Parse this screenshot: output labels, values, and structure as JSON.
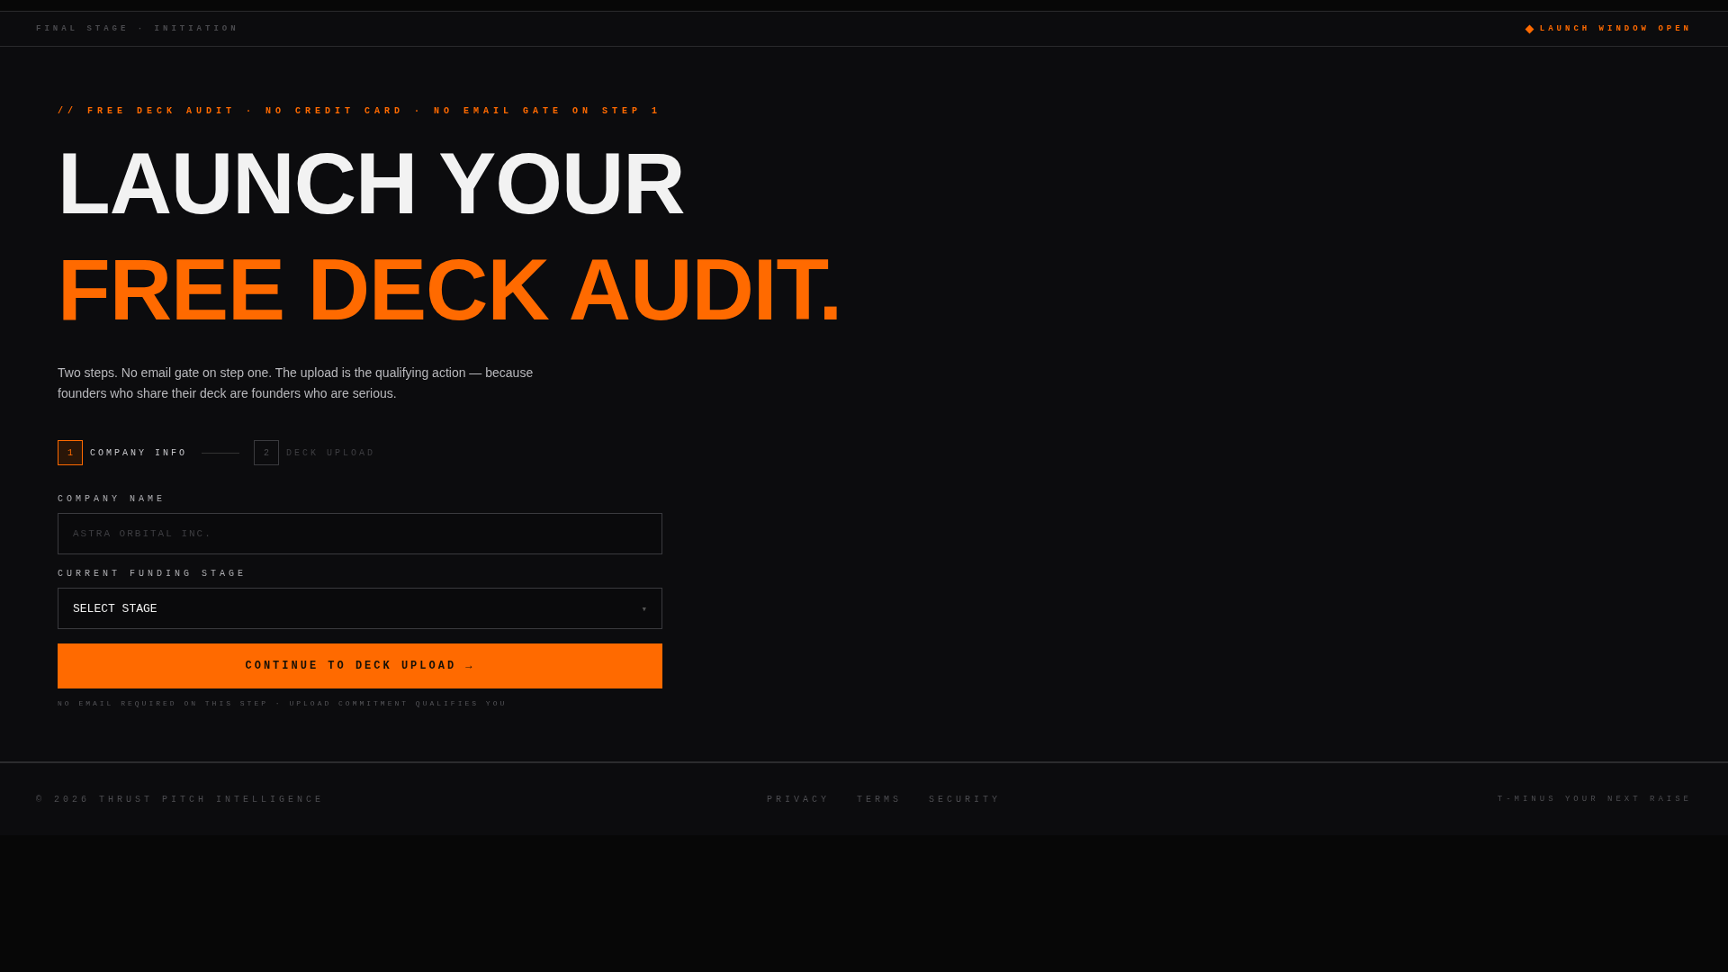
{
  "top_bar": {
    "stage_label": "FINAL STAGE · INITIATION",
    "status": {
      "label": "LAUNCH WINDOW OPEN",
      "on": true
    }
  },
  "hero": {
    "eyebrow": "// FREE DECK AUDIT · NO CREDIT CARD · NO EMAIL GATE ON STEP 1",
    "title_line_1": "LAUNCH YOUR",
    "title_line_2": "FREE DECK AUDIT.",
    "intro": "Two steps. No email gate on step one. The upload is the qualifying action — because founders who share their deck are founders who are serious."
  },
  "steps": [
    {
      "number": "1",
      "label": "COMPANY INFO",
      "selected": true
    },
    {
      "number": "2",
      "label": "DECK UPLOAD",
      "selected": false
    }
  ],
  "form": {
    "fields": [
      {
        "kind": "text",
        "label": "COMPANY NAME",
        "placeholder": "ASTRA ORBITAL INC."
      },
      {
        "kind": "select",
        "label": "CURRENT FUNDING STAGE",
        "value": "SELECT STAGE",
        "caret": "▾"
      }
    ],
    "submit": "CONTINUE TO DECK UPLOAD →",
    "note": "NO EMAIL REQUIRED ON THIS STEP · UPLOAD COMMITMENT QUALIFIES YOU"
  },
  "footer": {
    "copyright": "© 2026 THRUST PITCH INTELLIGENCE",
    "links": [
      "PRIVACY",
      "TERMS",
      "SECURITY"
    ],
    "tagline": "T-MINUS YOUR NEXT RAISE"
  }
}
